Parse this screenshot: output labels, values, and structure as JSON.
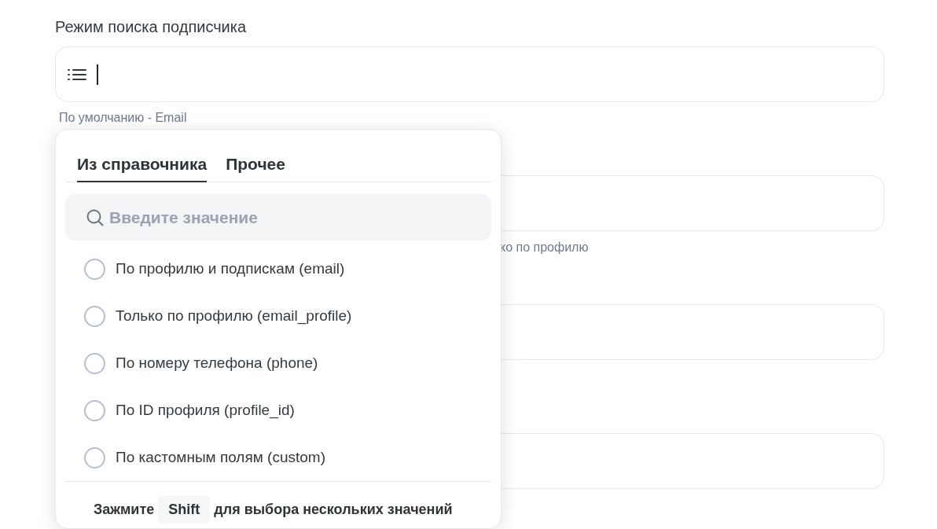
{
  "field": {
    "label": "Режим поиска подписчика",
    "hint": "По умолчанию - Email"
  },
  "background_hint": "ко по профилю",
  "dropdown": {
    "tabs": [
      {
        "label": "Из справочника",
        "selected": true
      },
      {
        "label": "Прочее",
        "selected": false
      }
    ],
    "search": {
      "placeholder": "Введите значение"
    },
    "options": [
      {
        "label": "По профилю и подпискам (email)",
        "selected": false
      },
      {
        "label": "Только по профилю (email_profile)",
        "selected": false
      },
      {
        "label": "По номеру телефона (phone)",
        "selected": false
      },
      {
        "label": "По ID профиля (profile_id)",
        "selected": false
      },
      {
        "label": "По кастомным полям (custom)",
        "selected": false
      }
    ],
    "footer": {
      "before": "Зажмите",
      "key": "Shift",
      "after": "для выбора нескольких значений"
    }
  }
}
